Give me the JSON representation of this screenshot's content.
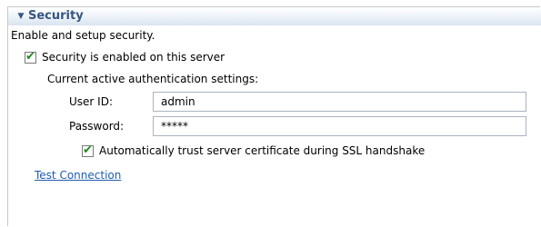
{
  "section": {
    "title": "Security",
    "description": "Enable and setup security."
  },
  "security_enabled": {
    "label": "Security is enabled on this server",
    "checked": true
  },
  "auth_settings_label": "Current active authentication settings:",
  "user_id": {
    "label": "User ID:",
    "value": "admin"
  },
  "password": {
    "label": "Password:",
    "value": "*****"
  },
  "trust_cert": {
    "label": "Automatically trust server certificate during SSL handshake",
    "checked": true
  },
  "test_connection_label": "Test Connection",
  "icons": {
    "twisty": "triangle-down",
    "checkmark": "check"
  },
  "colors": {
    "title": "#36557f",
    "link": "#1f5cac",
    "check": "#1e8a1e"
  }
}
